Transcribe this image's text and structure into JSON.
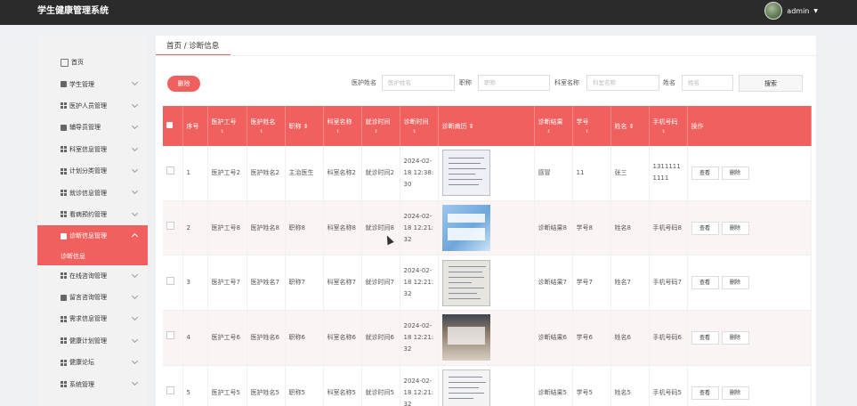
{
  "app": {
    "title": "学生健康管理系统",
    "user": "admin"
  },
  "sidebar": {
    "items": [
      {
        "label": "首页",
        "icon": "home-icon"
      },
      {
        "label": "学生管理",
        "icon": "student-icon"
      },
      {
        "label": "医护人员管理",
        "icon": "grid-icon"
      },
      {
        "label": "辅导员管理",
        "icon": "counselor-icon"
      },
      {
        "label": "科室信息管理",
        "icon": "grid-icon"
      },
      {
        "label": "计划分类管理",
        "icon": "grid-icon"
      },
      {
        "label": "就诊信息管理",
        "icon": "grid-icon"
      },
      {
        "label": "看病预约管理",
        "icon": "grid-icon"
      },
      {
        "label": "诊断信息管理",
        "icon": "grid-icon"
      },
      {
        "label": "在线咨询管理",
        "icon": "grid-icon"
      },
      {
        "label": "留言咨询管理",
        "icon": "message-icon"
      },
      {
        "label": "需求信息管理",
        "icon": "grid-icon"
      },
      {
        "label": "健康计划管理",
        "icon": "grid-icon"
      },
      {
        "label": "健康论坛",
        "icon": "grid-icon"
      },
      {
        "label": "系统管理",
        "icon": "grid-icon"
      }
    ],
    "active_sub": "诊断信息"
  },
  "breadcrumb": "首页 / 诊断信息",
  "toolbar": {
    "delete_label": "删除",
    "search_label": "搜索"
  },
  "search": {
    "fields": [
      {
        "label": "医护姓名",
        "placeholder": "医护姓名"
      },
      {
        "label": "职称",
        "placeholder": "职称"
      },
      {
        "label": "科室名称",
        "placeholder": "科室名称"
      },
      {
        "label": "姓名",
        "placeholder": "姓名"
      }
    ]
  },
  "table": {
    "headers": [
      "序号",
      "医护工号",
      "医护姓名",
      "职称",
      "科室名称",
      "就诊时间",
      "诊断时间",
      "诊断病历",
      "诊断结果",
      "学号",
      "姓名",
      "手机号码",
      "操作"
    ],
    "sort_mark": "⇕",
    "view_label": "查看",
    "delete_label": "删除",
    "rows": [
      {
        "no": "1",
        "staff_id": "医护工号2",
        "staff_name": "医护姓名2",
        "title": "主治医生",
        "dept": "科室名称2",
        "visit": "就诊时间2",
        "diag_time": "2024-02-18 12:38:30",
        "result": "感冒",
        "sid": "11",
        "name": "张三",
        "phone": "13111111111"
      },
      {
        "no": "2",
        "staff_id": "医护工号8",
        "staff_name": "医护姓名8",
        "title": "职称8",
        "dept": "科室名称8",
        "visit": "就诊时间8",
        "diag_time": "2024-02-18 12:21:32",
        "result": "诊断结果8",
        "sid": "学号8",
        "name": "姓名8",
        "phone": "手机号码8"
      },
      {
        "no": "3",
        "staff_id": "医护工号7",
        "staff_name": "医护姓名7",
        "title": "职称7",
        "dept": "科室名称7",
        "visit": "就诊时间7",
        "diag_time": "2024-02-18 12:21:32",
        "result": "诊断结果7",
        "sid": "学号7",
        "name": "姓名7",
        "phone": "手机号码7"
      },
      {
        "no": "4",
        "staff_id": "医护工号6",
        "staff_name": "医护姓名6",
        "title": "职称6",
        "dept": "科室名称6",
        "visit": "就诊时间6",
        "diag_time": "2024-02-18 12:21:32",
        "result": "诊断结果6",
        "sid": "学号6",
        "name": "姓名6",
        "phone": "手机号码6"
      },
      {
        "no": "5",
        "staff_id": "医护工号5",
        "staff_name": "医护姓名5",
        "title": "职称5",
        "dept": "科室名称5",
        "visit": "就诊时间5",
        "diag_time": "2024-02-18 12:21:32",
        "result": "诊断结果5",
        "sid": "学号5",
        "name": "姓名5",
        "phone": "手机号码5"
      }
    ]
  },
  "colors": {
    "accent": "#f0605e",
    "topbar": "#2b2b2b"
  }
}
